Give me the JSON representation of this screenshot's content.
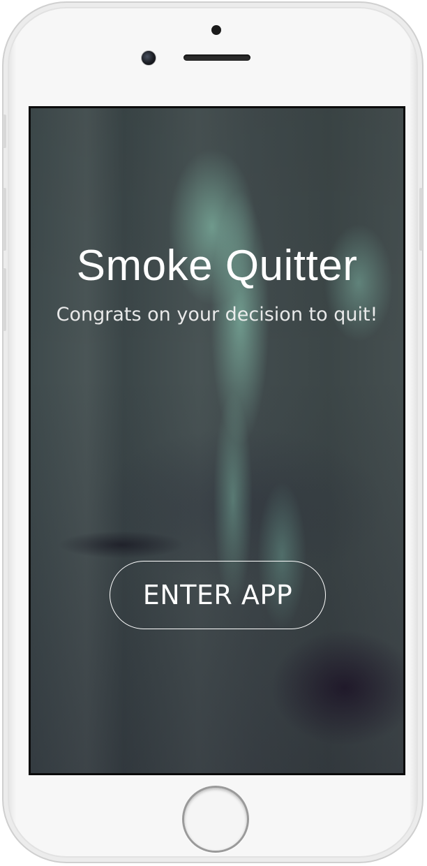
{
  "app": {
    "title": "Smoke Quitter",
    "subtitle": "Congrats on your decision to quit!",
    "enter_button_label": "ENTER APP"
  },
  "colors": {
    "text": "#ffffff",
    "smoke_accent": "#96dcc3",
    "background_dark": "#3e4a4c",
    "device_frame": "#f7f7f7"
  },
  "icons": {
    "front_camera": "front-camera-icon",
    "sensor": "sensor-icon",
    "speaker": "speaker-grille-icon",
    "home_button": "home-button-icon"
  }
}
